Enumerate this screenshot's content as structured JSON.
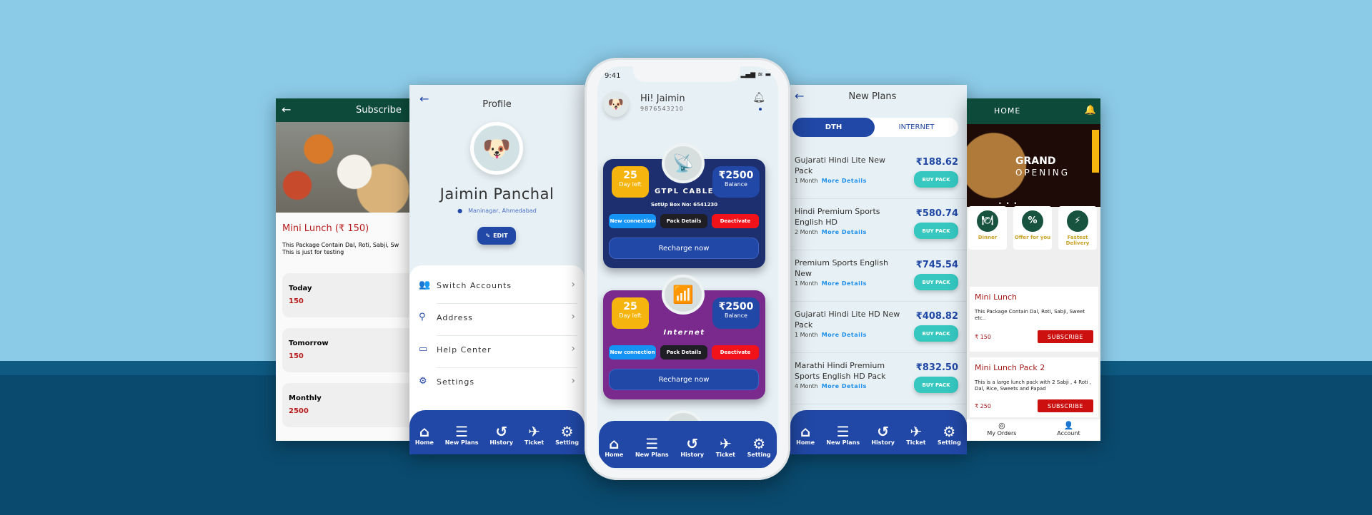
{
  "colors": {
    "sky": "#8ccbe8",
    "navy": "#0a4a6e",
    "brand_blue": "#2148a6",
    "food_green": "#0d4a3a",
    "teal": "#35c7c0",
    "red": "#cc1010"
  },
  "subscribe": {
    "title": "Subscribe",
    "item_title": "Mini Lunch (₹ 150)",
    "description": "This Package Contain Dal, Roti, Sabji, Sw",
    "description2": "This is just for testing",
    "options": [
      {
        "label": "Today",
        "value": "150"
      },
      {
        "label": "Tomorrow",
        "value": "150"
      },
      {
        "label": "Monthly",
        "value": "2500"
      }
    ]
  },
  "profile": {
    "title": "Profile",
    "name": "Jaimin Panchal",
    "location": "Maninagar, Ahmedabad",
    "edit": "EDIT",
    "menu": [
      {
        "label": "Switch Accounts",
        "icon": "users-icon"
      },
      {
        "label": "Address",
        "icon": "pin-icon"
      },
      {
        "label": "Help Center",
        "icon": "chat-icon"
      },
      {
        "label": "Settings",
        "icon": "gear-icon"
      }
    ]
  },
  "nav": [
    {
      "label": "Home",
      "icon": "home-icon"
    },
    {
      "label": "New Plans",
      "icon": "list-icon"
    },
    {
      "label": "History",
      "icon": "history-icon"
    },
    {
      "label": "Ticket",
      "icon": "ticket-icon"
    },
    {
      "label": "Setting",
      "icon": "gear-icon"
    }
  ],
  "phone": {
    "time": "9:41",
    "greeting": "Hi! Jaimin",
    "phone_number": "9876543210",
    "cards": [
      {
        "days": "25",
        "days_label": "Day left",
        "balance": "₹2500",
        "balance_label": "Balance",
        "name": "GTPL CABLE",
        "sub": "SetUp Box No: 6541230",
        "new": "New connection",
        "pack": "Pack Details",
        "deactivate": "Deactivate",
        "recharge": "Recharge now",
        "color": "#1d2f6e"
      },
      {
        "days": "25",
        "days_label": "Day left",
        "balance": "₹2500",
        "balance_label": "Balance",
        "name": "Internet",
        "sub": "",
        "new": "New connection",
        "pack": "Pack Details",
        "deactivate": "Deactivate",
        "recharge": "Recharge now",
        "color": "#7a2a8c"
      }
    ]
  },
  "plans": {
    "title": "New Plans",
    "tabs": [
      "DTH",
      "INTERNET"
    ],
    "active_tab": "DTH",
    "buy": "BUY PACK",
    "more": "More Details",
    "items": [
      {
        "name": "Gujarati Hindi Lite New Pack",
        "duration": "1 Month",
        "price": "₹188.62"
      },
      {
        "name": "Hindi Premium Sports English HD",
        "duration": "2 Month",
        "price": "₹580.74"
      },
      {
        "name": "Premium Sports English New",
        "duration": "1 Month",
        "price": "₹745.54"
      },
      {
        "name": "Gujarati Hindi Lite HD New Pack",
        "duration": "1 Month",
        "price": "₹408.82"
      },
      {
        "name": "Marathi Hindi Premium Sports English HD Pack",
        "duration": "4 Month",
        "price": "₹832.50"
      }
    ]
  },
  "food": {
    "title": "HOME",
    "banner_line1": "GRAND",
    "banner_line2": "OPENING",
    "categories": [
      "Dinner",
      "Offer for you",
      "Fastest Delivery"
    ],
    "cards": [
      {
        "title": "Mini Lunch",
        "desc": "This Package Contain Dal, Roti, Sabji, Sweet etc..",
        "price": "₹ 150",
        "action": "SUBSCRIBE"
      },
      {
        "title": "Mini Lunch Pack 2",
        "desc": "This is a large lunch pack with 2 Sabji , 4 Roti , Dal, Rice, Sweets and Papad",
        "price": "₹ 250",
        "action": "SUBSCRIBE"
      }
    ],
    "bottom": [
      "My Orders",
      "Account"
    ]
  }
}
